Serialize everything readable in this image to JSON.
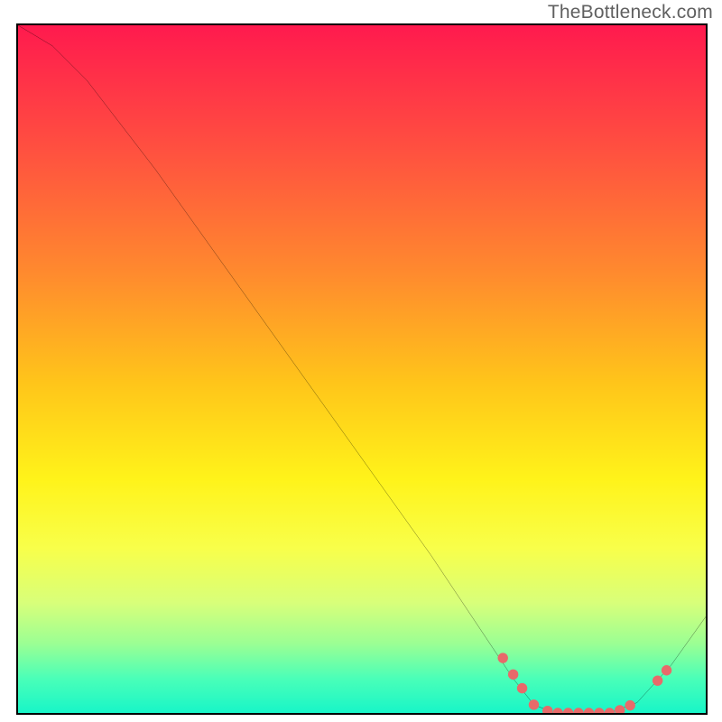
{
  "watermark": {
    "text": "TheBottleneck.com"
  },
  "chart_data": {
    "type": "line",
    "title": "",
    "xlabel": "",
    "ylabel": "",
    "xlim": [
      0,
      100
    ],
    "ylim": [
      0,
      100
    ],
    "grid": false,
    "curve": {
      "name": "bottleneck-curve",
      "points": [
        {
          "x": 0,
          "y": 100
        },
        {
          "x": 5,
          "y": 97
        },
        {
          "x": 10,
          "y": 92
        },
        {
          "x": 20,
          "y": 79
        },
        {
          "x": 30,
          "y": 65
        },
        {
          "x": 40,
          "y": 51
        },
        {
          "x": 50,
          "y": 37
        },
        {
          "x": 60,
          "y": 23
        },
        {
          "x": 68,
          "y": 11
        },
        {
          "x": 72,
          "y": 5
        },
        {
          "x": 75,
          "y": 1.2
        },
        {
          "x": 78,
          "y": 0
        },
        {
          "x": 86,
          "y": 0
        },
        {
          "x": 90,
          "y": 1.5
        },
        {
          "x": 95,
          "y": 7
        },
        {
          "x": 100,
          "y": 14
        }
      ]
    },
    "markers": {
      "name": "trough-markers",
      "color": "#e86a6a",
      "points": [
        {
          "x": 70.5,
          "y": 8.0
        },
        {
          "x": 72.0,
          "y": 5.6
        },
        {
          "x": 73.3,
          "y": 3.6
        },
        {
          "x": 75.0,
          "y": 1.2
        },
        {
          "x": 77.0,
          "y": 0.3
        },
        {
          "x": 78.5,
          "y": 0.0
        },
        {
          "x": 80.0,
          "y": 0.0
        },
        {
          "x": 81.5,
          "y": 0.0
        },
        {
          "x": 83.0,
          "y": 0.0
        },
        {
          "x": 84.5,
          "y": 0.0
        },
        {
          "x": 86.0,
          "y": 0.0
        },
        {
          "x": 87.5,
          "y": 0.4
        },
        {
          "x": 89.0,
          "y": 1.1
        },
        {
          "x": 93.0,
          "y": 4.7
        },
        {
          "x": 94.3,
          "y": 6.2
        }
      ]
    }
  }
}
